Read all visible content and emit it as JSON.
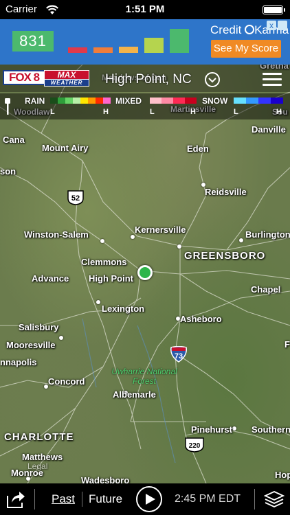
{
  "status_bar": {
    "carrier": "Carrier",
    "time": "1:51 PM"
  },
  "ad": {
    "score": "831",
    "brand_left": "Credit ",
    "brand_right": "Karma",
    "cta": "See My Score",
    "close": "x"
  },
  "header": {
    "logo_fox": "FOX 8",
    "logo_max": "MAX",
    "logo_weather": "WEATHER",
    "location": "High Point, NC"
  },
  "legend": {
    "rain": "RAIN",
    "mixed": "MIXED",
    "snow": "SNOW",
    "low": "L",
    "high": "H",
    "colors": {
      "rain": [
        "#1a4d1a",
        "#2e9e3a",
        "#66d466",
        "#b8f0a8",
        "#ffe600",
        "#ff9900",
        "#ff2a00",
        "#ff66cc"
      ],
      "mixed": [
        "#ffc0cb",
        "#ff8aa5",
        "#ff2a55",
        "#c8001e"
      ],
      "snow": [
        "#66e0ff",
        "#3399ff",
        "#3333ff",
        "#1a00cc"
      ]
    }
  },
  "map": {
    "cities": {
      "woodlawn": "Woodlaw",
      "martinsville": "Martinsville",
      "meadows": "Meadows of Dan",
      "south_boston": "Sou",
      "cana": "Cana",
      "mount_airy": "Mount Airy",
      "eden": "Eden",
      "danville": "Danville",
      "jefferson": "son",
      "reidsville": "Reidsville",
      "kernersville": "Kernersville",
      "winston_salem": "Winston-Salem",
      "burlington": "Burlington",
      "clemmons": "Clemmons",
      "greensboro": "GREENSBORO",
      "advance": "Advance",
      "high_point": "High Point",
      "chapel": "Chapel",
      "lexington": "Lexington",
      "salisbury": "Salisbury",
      "asheboro": "Asheboro",
      "mooresville": "Mooresville",
      "annapolis": "nnapolis",
      "concord": "Concord",
      "albemarle": "Albemarle",
      "charlotte": "CHARLOTTE",
      "pinehurst": "Pinehurst",
      "southern": "Southern",
      "matthews": "Matthews",
      "monroe": "Monroe",
      "wadesboro": "Wadesboro",
      "hope": "Hop",
      "gretna": "Gretna",
      "f": "F"
    },
    "forest": "Uwharrie National Forest",
    "shields": {
      "us52": "52",
      "i73": "73",
      "us220": "220"
    },
    "legal": "Legal"
  },
  "bottom": {
    "past": "Past",
    "future": "Future",
    "timestamp": "2:45 PM EDT"
  }
}
